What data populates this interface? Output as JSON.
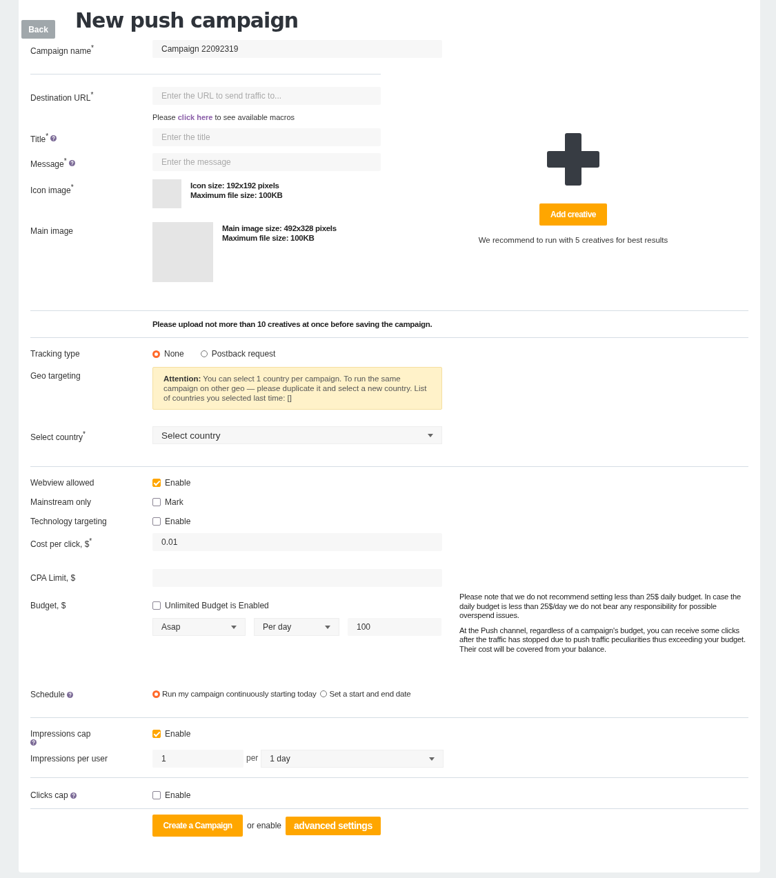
{
  "back_button": "Back",
  "title": "New push campaign",
  "campaign_name": {
    "label": "Campaign name$^{*}$",
    "value": "Campaign 22092319"
  },
  "destination_url": {
    "label": "Destination URL$^{*}$",
    "placeholder": "Enter the URL to send traffic to...",
    "hint_before": "Please",
    "hint_link": "click here",
    "hint_after": "to see available macros"
  },
  "title_field": {
    "label": "Title$^{*}$",
    "help": true,
    "placeholder": "Enter the title"
  },
  "message_field": {
    "label": "Message$^{*}$",
    "help": true,
    "placeholder": "Enter the message"
  },
  "icon_image": {
    "label": "Icon image$^{*}$",
    "notes": [
      "Icon size: 192x192 pixels",
      "Maximum file size: 100KB"
    ]
  },
  "main_image": {
    "label": "Main image",
    "notes": [
      "Main image size: 492x328 pixels",
      "Maximum file size: 100KB"
    ]
  },
  "creative_panel": {
    "button": "Add creative",
    "recommendation": "We recommend to run with 5 creatives for best results"
  },
  "upload_notice": "Please upload not more than 10 creatives at once before saving the campaign.",
  "tracking_type": {
    "label": "Tracking type",
    "options": [
      {
        "label": "None",
        "selected": true
      },
      {
        "label": "Postback request",
        "selected": false
      }
    ]
  },
  "geo_targeting": {
    "label": "Geo targeting",
    "alert": "**Attention:** You can select 1 country per campaign. To run the same campaign on other geo — please duplicate it and select a new country. List of countries you selected last time: []"
  },
  "select_country": {
    "label": "Select country$^{*}$",
    "value": "Select country"
  },
  "toggles": [
    {
      "label": "Webview allowed",
      "option": "Enable",
      "checked": true
    },
    {
      "label": "Mainstream only",
      "option": "Mark",
      "checked": false
    },
    {
      "label": "Technology targeting",
      "option": "Enable",
      "checked": false
    }
  ],
  "cost_per_click": {
    "label": "Cost per click, $$^{*}$",
    "value": "0.01"
  },
  "cpa_limit": {
    "label": "CPA Limit, $"
  },
  "budget": {
    "label": "Budget, $",
    "unlimited": {
      "label": "Unlimited Budget is Enabled",
      "checked": false
    },
    "pacing": "Asap",
    "period": "Per day",
    "amount": "100",
    "notes": [
      "Please note that we do not recommend setting less than 25$ daily budget. In case the daily budget is less than 25$/day we do not bear any responsibility for possible overspend issues.",
      "At the Push channel, regardless of a campaign's budget, you can receive some clicks after the traffic has stopped due to push traffic peculiarities thus exceeding your budget. Their cost will be covered from your balance."
    ]
  },
  "schedule": {
    "label": "Schedule",
    "help": true,
    "options": [
      {
        "label": "Run my campaign continuously starting today",
        "selected": true
      },
      {
        "label": "Set a start and end date",
        "selected": false
      }
    ]
  },
  "impressions_cap": {
    "label": "Impressions cap",
    "help": true,
    "option": "Enable",
    "checked": true
  },
  "impressions_per_user": {
    "label": "Impressions per user",
    "value": "1",
    "per": "per",
    "period": "1 day"
  },
  "clicks_cap": {
    "label": "Clicks cap",
    "help": true,
    "option": "Enable",
    "checked": false
  },
  "actions": {
    "create": "Create a Campaign",
    "connector": "or enable",
    "advanced": "advanced settings"
  }
}
